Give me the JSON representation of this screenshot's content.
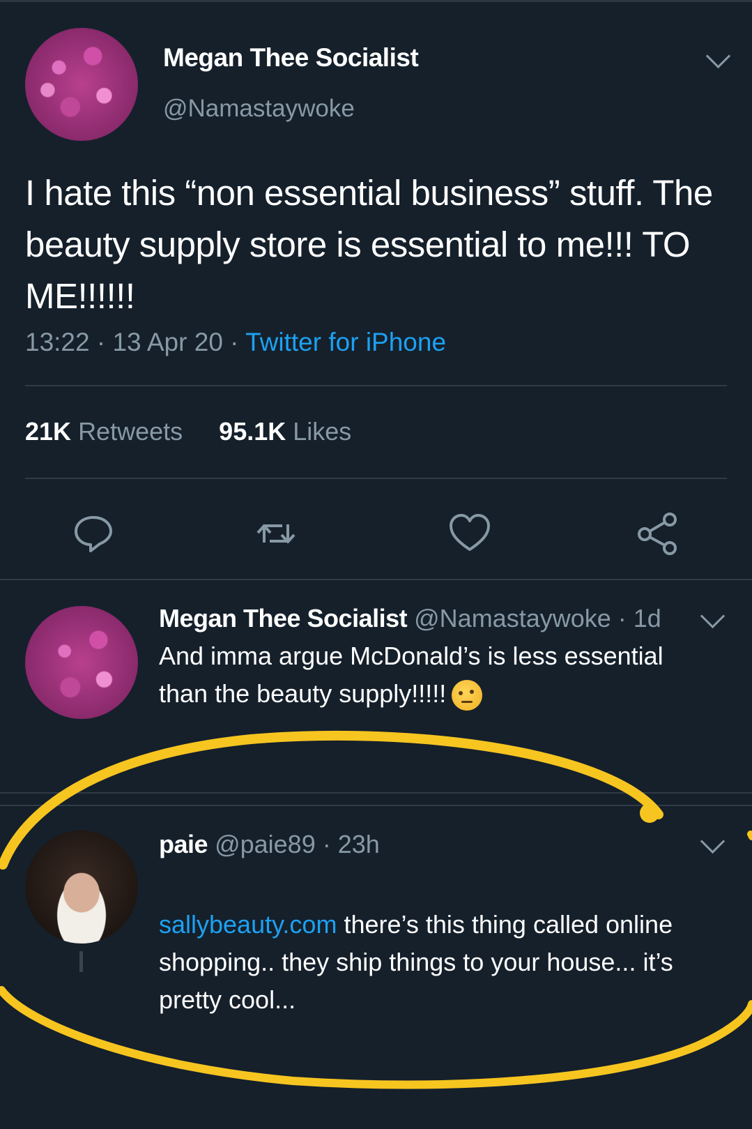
{
  "tweet": {
    "author_name": "Megan Thee Socialist",
    "author_handle": "@Namastaywoke",
    "text": "I hate this “non essential business” stuff. The beauty supply store is essential to me!!! TO ME!!!!!!",
    "time": "13:22",
    "date": "13 Apr 20",
    "separator": "·",
    "source": "Twitter for iPhone",
    "retweets_count": "21K",
    "retweets_label": "Retweets",
    "likes_count": "95.1K",
    "likes_label": "Likes"
  },
  "actions": {
    "reply_icon": "reply-icon",
    "retweet_icon": "retweet-icon",
    "like_icon": "heart-icon",
    "share_icon": "share-icon"
  },
  "replies": [
    {
      "name": "Megan Thee Socialist",
      "handle": "@Namastaywoke",
      "age": "· 1d",
      "text": "And imma argue McDonald’s is less essential than the beauty supply!!!!!",
      "emoji": "face-with-raised-eyebrow"
    },
    {
      "name": "paie",
      "handle": "@paie89",
      "age": "· 23h",
      "link": "sallybeauty.com",
      "text": " there’s this thing called online shopping.. they ship things to your house... it’s pretty cool..."
    }
  ],
  "colors": {
    "background": "#15202b",
    "secondary_text": "#8899a6",
    "link": "#1da1f2",
    "highlight": "#f7c520"
  }
}
